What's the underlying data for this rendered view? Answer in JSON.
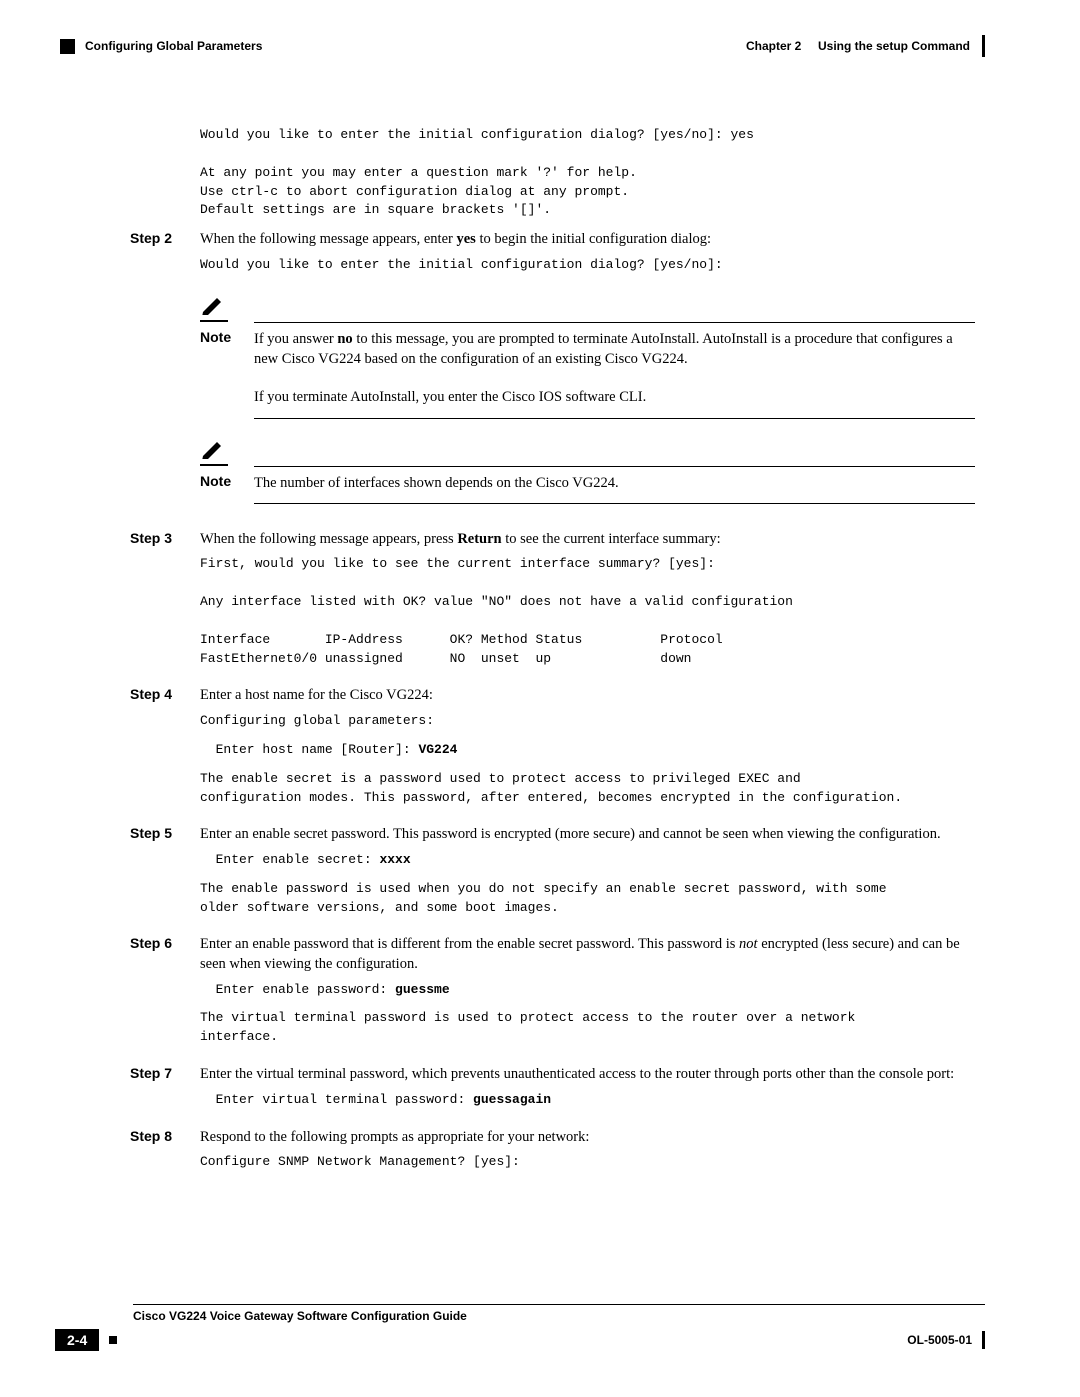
{
  "header": {
    "section": "Configuring Global Parameters",
    "chapter_label": "Chapter 2",
    "chapter_title": "Using the setup Command"
  },
  "intro_mono": "Would you like to enter the initial configuration dialog? [yes/no]: yes\n\nAt any point you may enter a question mark '?' for help.\nUse ctrl-c to abort configuration dialog at any prompt.\nDefault settings are in square brackets '[]'.",
  "step2": {
    "label": "Step 2",
    "text_before": "When the following message appears, enter ",
    "text_bold": "yes",
    "text_after": " to begin the initial configuration dialog:",
    "mono": "Would you like to enter the initial configuration dialog? [yes/no]:",
    "note1_label": "Note",
    "note1_before": "If you answer ",
    "note1_bold": "no",
    "note1_after": " to this message, you are prompted to terminate AutoInstall. AutoInstall is a procedure that configures a new Cisco VG224 based on the configuration of an existing Cisco VG224.",
    "note1_extra": "If you terminate AutoInstall, you enter the Cisco IOS software CLI.",
    "note2_label": "Note",
    "note2_text": "The number of interfaces shown depends on the Cisco VG224."
  },
  "step3": {
    "label": "Step 3",
    "text_before": "When the following message appears, press ",
    "text_bold": "Return",
    "text_after": " to see the current interface summary:",
    "mono": "First, would you like to see the current interface summary? [yes]:\n\nAny interface listed with OK? value \"NO\" does not have a valid configuration\n\nInterface       IP-Address      OK? Method Status          Protocol\nFastEthernet0/0 unassigned      NO  unset  up              down"
  },
  "step4": {
    "label": "Step 4",
    "text": "Enter a host name for the Cisco VG224:",
    "mono1": "Configuring global parameters:",
    "mono2_prefix": "  Enter host name [Router]: ",
    "mono2_bold": "VG224",
    "mono3": "The enable secret is a password used to protect access to privileged EXEC and\nconfiguration modes. This password, after entered, becomes encrypted in the configuration."
  },
  "step5": {
    "label": "Step 5",
    "text": "Enter an enable secret password. This password is encrypted (more secure) and cannot be seen when viewing the configuration.",
    "mono1_prefix": "  Enter enable secret: ",
    "mono1_bold": "xxxx",
    "mono2": "The enable password is used when you do not specify an enable secret password, with some\nolder software versions, and some boot images."
  },
  "step6": {
    "label": "Step 6",
    "text_before": "Enter an enable password that is different from the enable secret password. This password is ",
    "text_italic": "not",
    "text_after": " encrypted (less secure) and can be seen when viewing the configuration.",
    "mono1_prefix": "  Enter enable password: ",
    "mono1_bold": "guessme",
    "mono2": "The virtual terminal password is used to protect access to the router over a network\ninterface."
  },
  "step7": {
    "label": "Step 7",
    "text": "Enter the virtual terminal password, which prevents unauthenticated access to the router through ports other than the console port:",
    "mono_prefix": "  Enter virtual terminal password: ",
    "mono_bold": "guessagain"
  },
  "step8": {
    "label": "Step 8",
    "text": "Respond to the following prompts as appropriate for your network:",
    "mono": "Configure SNMP Network Management? [yes]:"
  },
  "footer": {
    "title": "Cisco VG224 Voice Gateway Software Configuration Guide",
    "page": "2-4",
    "doc": "OL-5005-01"
  }
}
